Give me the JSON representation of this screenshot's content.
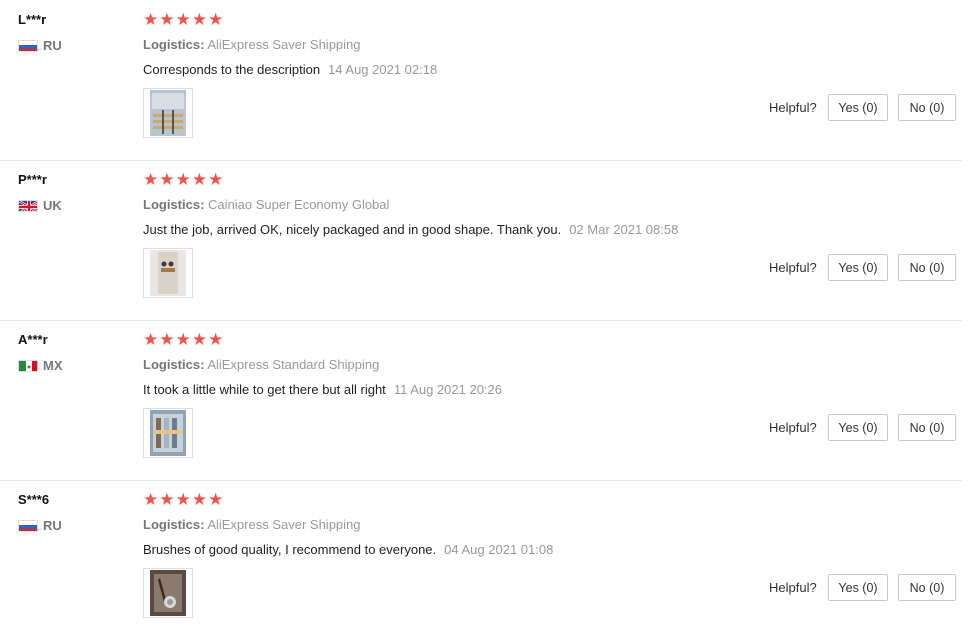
{
  "colors": {
    "star": "#f2524a",
    "muted": "#999999",
    "border": "#e8e8e8"
  },
  "helpful_label": "Helpful?",
  "reviews": [
    {
      "user": "L***r",
      "country": "RU",
      "flag": "ru-flag-icon",
      "stars": "★★★★★",
      "logistics_label": "Logistics:",
      "logistics": "AliExpress Saver Shipping",
      "comment": "Corresponds to the description",
      "date": "14 Aug 2021 02:18",
      "yes": "Yes (0)",
      "no": "No (0)"
    },
    {
      "user": "P***r",
      "country": "UK",
      "flag": "uk-flag-icon",
      "stars": "★★★★★",
      "logistics_label": "Logistics:",
      "logistics": "Cainiao Super Economy Global",
      "comment": "Just the job, arrived OK, nicely packaged and in good shape. Thank you.",
      "date": "02 Mar 2021 08:58",
      "yes": "Yes (0)",
      "no": "No (0)"
    },
    {
      "user": "A***r",
      "country": "MX",
      "flag": "mx-flag-icon",
      "stars": "★★★★★",
      "logistics_label": "Logistics:",
      "logistics": "AliExpress Standard Shipping",
      "comment": "It took a little while to get there but all right",
      "date": "11 Aug 2021 20:26",
      "yes": "Yes (0)",
      "no": "No (0)"
    },
    {
      "user": "S***6",
      "country": "RU",
      "flag": "ru-flag-icon",
      "stars": "★★★★★",
      "logistics_label": "Logistics:",
      "logistics": "AliExpress Saver Shipping",
      "comment": "Brushes of good quality, I recommend to everyone.",
      "date": "04 Aug 2021 01:08",
      "yes": "Yes (0)",
      "no": "No (0)"
    }
  ]
}
